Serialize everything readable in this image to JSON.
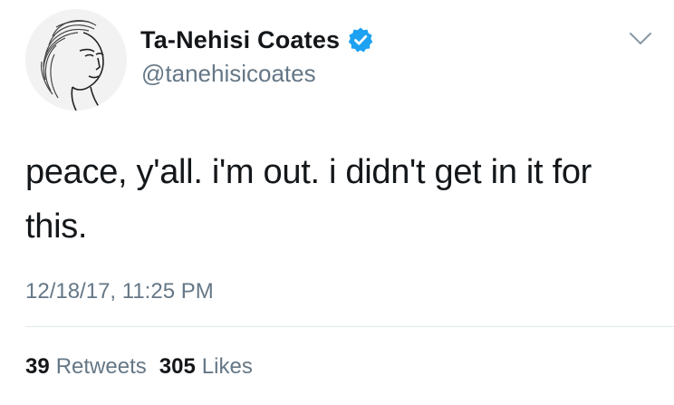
{
  "author": {
    "display_name": "Ta-Nehisi Coates",
    "handle": "@tanehisicoates",
    "verified": true,
    "avatar_icon": "portrait-sketch-avatar"
  },
  "tweet": {
    "text": "peace, y'all. i'm out. i didn't get in it for this.",
    "timestamp": "12/18/17, 11:25 PM"
  },
  "stats": {
    "retweets_count": "39",
    "retweets_label": "Retweets",
    "likes_count": "305",
    "likes_label": "Likes"
  },
  "colors": {
    "verified_blue": "#1da1f2",
    "secondary_text": "#657786",
    "primary_text": "#14171a",
    "divider": "#e1e8ed"
  }
}
